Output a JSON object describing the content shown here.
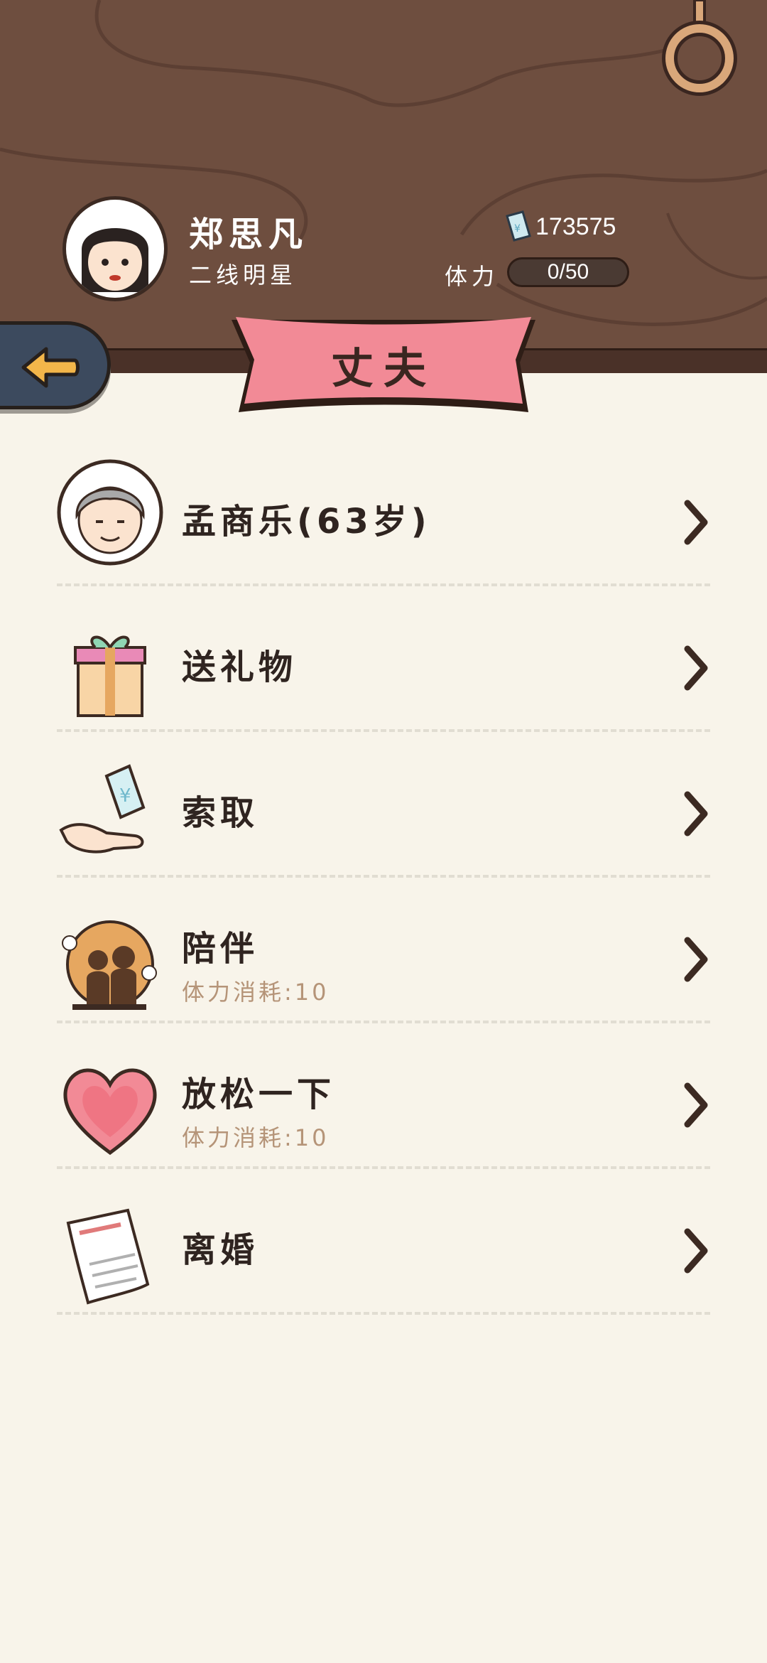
{
  "player": {
    "name": "郑思凡",
    "title": "二线明星",
    "money": "173575",
    "stamina_label": "体力",
    "stamina": "0/50"
  },
  "page": {
    "title": "丈夫"
  },
  "menu": [
    {
      "label": "孟商乐(63岁)",
      "sub": "",
      "icon": "husband-avatar-icon"
    },
    {
      "label": "送礼物",
      "sub": "",
      "icon": "gift-icon"
    },
    {
      "label": "索取",
      "sub": "",
      "icon": "money-hand-icon"
    },
    {
      "label": "陪伴",
      "sub": "体力消耗:10",
      "icon": "companion-icon"
    },
    {
      "label": "放松一下",
      "sub": "体力消耗:10",
      "icon": "heart-icon"
    },
    {
      "label": "离婚",
      "sub": "",
      "icon": "divorce-certificate-icon"
    }
  ],
  "icons": {
    "back": "back-arrow-icon",
    "money": "money-note-icon",
    "ring": "hanging-ring-icon",
    "chevron": "chevron-right-icon"
  },
  "colors": {
    "wood": "#6e4e3f",
    "banner": "#f28a96",
    "background": "#f8f4ea",
    "back_button": "#3c4a5e",
    "arrow": "#f3b64a",
    "sub_text": "#b59478"
  }
}
